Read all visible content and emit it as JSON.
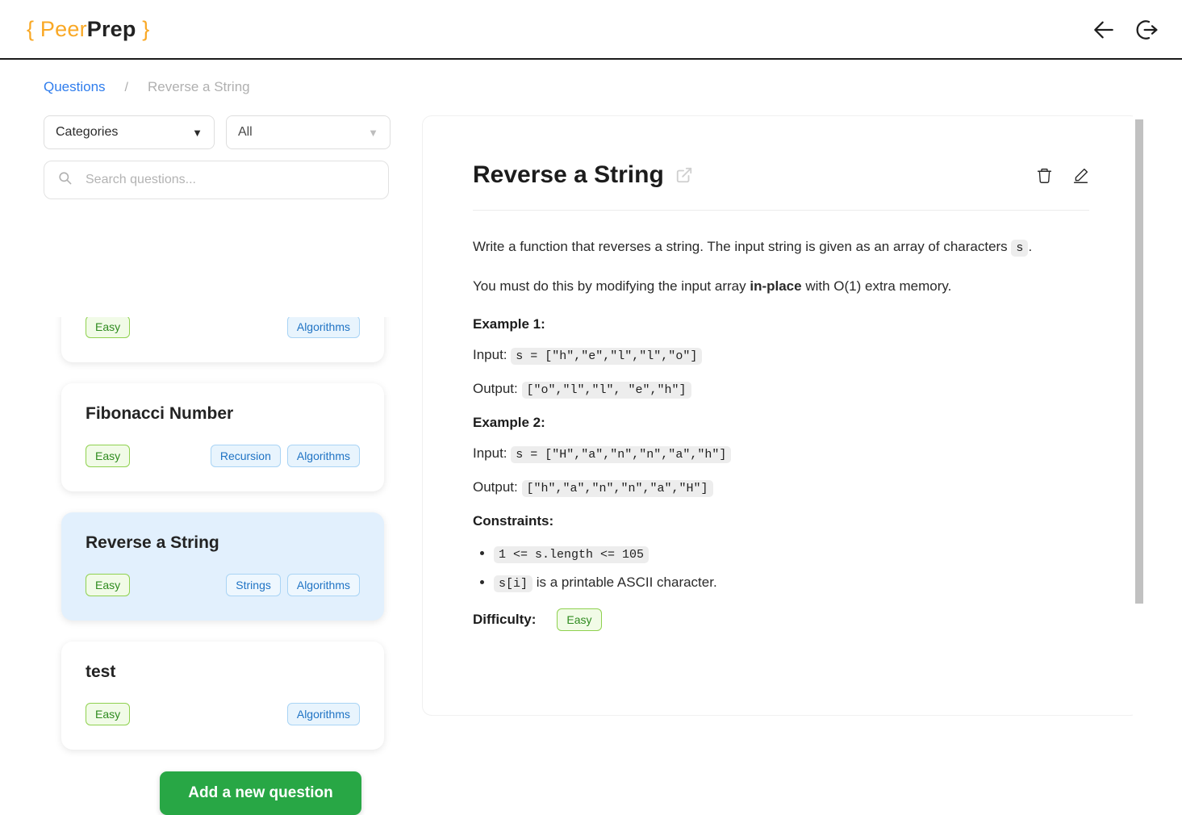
{
  "header": {
    "logo": {
      "open_brace": "{",
      "peer": "Peer",
      "prep": "Prep",
      "close_brace": "}"
    },
    "back_icon": "back-arrow-icon",
    "logout_icon": "logout-icon"
  },
  "breadcrumb": {
    "root_label": "Questions",
    "separator": "/",
    "current_label": "Reverse a String"
  },
  "sidebar": {
    "filters": {
      "category_select": {
        "value": "Categories",
        "chevron": "chevron-down-icon"
      },
      "difficulty_select": {
        "value": "All",
        "chevron": "chevron-down-icon"
      }
    },
    "search": {
      "placeholder": "Search questions...",
      "value": "",
      "icon": "search-icon"
    },
    "questions": [
      {
        "title": "",
        "difficulty": "Easy",
        "tags": [
          "Algorithms"
        ],
        "selected": false,
        "clipped": true
      },
      {
        "title": "Fibonacci Number",
        "difficulty": "Easy",
        "tags": [
          "Recursion",
          "Algorithms"
        ],
        "selected": false
      },
      {
        "title": "Reverse a String",
        "difficulty": "Easy",
        "tags": [
          "Strings",
          "Algorithms"
        ],
        "selected": true
      },
      {
        "title": "test",
        "difficulty": "Easy",
        "tags": [
          "Algorithms"
        ],
        "selected": false
      }
    ],
    "add_button_label": "Add a new question"
  },
  "main": {
    "title": "Reverse a String",
    "external_link_icon": "external-link-icon",
    "delete_icon": "trash-icon",
    "edit_icon": "pencil-edit-icon",
    "description": {
      "para1_pre": "Write a function that reverses a string. The input string is given as an array of characters ",
      "para1_code": "s",
      "para1_post": ".",
      "para2_pre": "You must do this by modifying the input array ",
      "para2_bold": "in-place",
      "para2_post": " with O(1) extra memory."
    },
    "examples": [
      {
        "heading": "Example 1:",
        "input_label": "Input:",
        "input_code": "s = [\"h\",\"e\",\"l\",\"l\",\"o\"]",
        "output_label": "Output:",
        "output_code": "[\"o\",\"l\",\"l\", \"e\",\"h\"]"
      },
      {
        "heading": "Example 2:",
        "input_label": "Input:",
        "input_code": "s = [\"H\",\"a\",\"n\",\"n\",\"a\",\"h\"]",
        "output_label": "Output:",
        "output_code": "[\"h\",\"a\",\"n\",\"n\",\"a\",\"H\"]"
      }
    ],
    "constraints": {
      "heading": "Constraints:",
      "item1_code": "1 <= s.length <= 105",
      "item1_text": "",
      "item2_code": "s[i]",
      "item2_text": " is a printable ASCII character."
    },
    "difficulty": {
      "label": "Difficulty:",
      "value": "Easy"
    }
  },
  "colors": {
    "brand_orange": "#f9a825",
    "link_blue": "#2f7ded",
    "selected_card_blue": "#e2f0fd",
    "easy_green_text": "#2e8b1f",
    "easy_green_bg": "#f1fbe7",
    "tag_blue_text": "#1f73c4",
    "tag_blue_bg": "#e8f4fd",
    "add_button_green": "#28a745",
    "scrollbar_thumb": "#c1c1c1"
  }
}
